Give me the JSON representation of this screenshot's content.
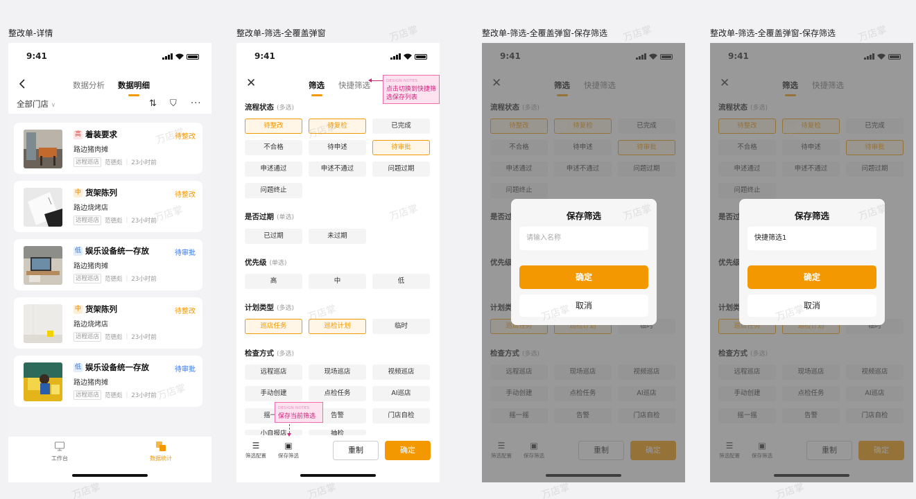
{
  "frames": [
    {
      "title": "整改单-详情"
    },
    {
      "title": "整改单-筛选-全覆盖弹窗"
    },
    {
      "title": "整改单-筛选-全覆盖弹窗-保存筛选"
    },
    {
      "title": "整改单-筛选-全覆盖弹窗-保存筛选"
    }
  ],
  "status_time": "9:41",
  "watermark": "万店掌",
  "detail": {
    "tabs": [
      "数据分析",
      "数据明细"
    ],
    "store_filter": "全部门店",
    "cards": [
      {
        "priority": "高",
        "title": "着装要求",
        "status": "待整改",
        "store": "路边猪肉摊",
        "tag": "远程巡店",
        "person": "范德彪",
        "time": "23小时前"
      },
      {
        "priority": "中",
        "title": "货架陈列",
        "status": "待整改",
        "store": "路边烧烤店",
        "tag": "远程巡店",
        "person": "范德彪",
        "time": "23小时前"
      },
      {
        "priority": "低",
        "title": "娱乐设备统一存放",
        "status": "待审批",
        "store": "路边猪肉摊",
        "tag": "远程巡店",
        "person": "范德彪",
        "time": "23小时前"
      },
      {
        "priority": "中",
        "title": "货架陈列",
        "status": "待整改",
        "store": "路边烧烤店",
        "tag": "远程巡店",
        "person": "范德彪",
        "time": "23小时前"
      },
      {
        "priority": "低",
        "title": "娱乐设备统一存放",
        "status": "待审批",
        "store": "路边猪肉摊",
        "tag": "远程巡店",
        "person": "范德彪",
        "time": "23小时前"
      }
    ],
    "tabbar": [
      "工作台",
      "数据统计"
    ]
  },
  "filter": {
    "tabs": [
      "筛选",
      "快捷筛选"
    ],
    "sections": {
      "flow": {
        "title": "流程状态",
        "hint": "(多选)",
        "options": [
          "待整改",
          "待复检",
          "已完成",
          "不合格",
          "待申述",
          "待审批",
          "申述通过",
          "申述不通过",
          "问题过期",
          "问题终止"
        ]
      },
      "expired": {
        "title": "是否过期",
        "hint": "(单选)",
        "options": [
          "已过期",
          "未过期"
        ]
      },
      "priority": {
        "title": "优先级",
        "hint": "(单选)",
        "options": [
          "高",
          "中",
          "低"
        ]
      },
      "plan": {
        "title": "计划类型",
        "hint": "(多选)",
        "options": [
          "巡店任务",
          "巡检计划",
          "临时"
        ]
      },
      "method": {
        "title": "检查方式",
        "hint": "(多选)",
        "options": [
          "远程巡店",
          "现场巡店",
          "视频巡店",
          "手动创建",
          "点检任务",
          "AI巡店",
          "摇一摇",
          "告警",
          "门店自检",
          "小自报店",
          "抽检"
        ]
      }
    },
    "footer": {
      "config": "筛选配置",
      "save": "保存筛选",
      "reset": "重制",
      "confirm": "确定"
    }
  },
  "notes": {
    "header": "DESIGN NOTES",
    "switch": "点击切换到快捷筛选保存列表",
    "save": "保存当前筛选"
  },
  "dialog": {
    "title": "保存筛选",
    "placeholder": "请输入名称",
    "value": "快捷筛选1",
    "confirm": "确定",
    "cancel": "取消"
  },
  "colors": {
    "accent": "#f39800",
    "blue": "#2f74e8",
    "red": "#e0453a",
    "note": "#d1237e"
  }
}
